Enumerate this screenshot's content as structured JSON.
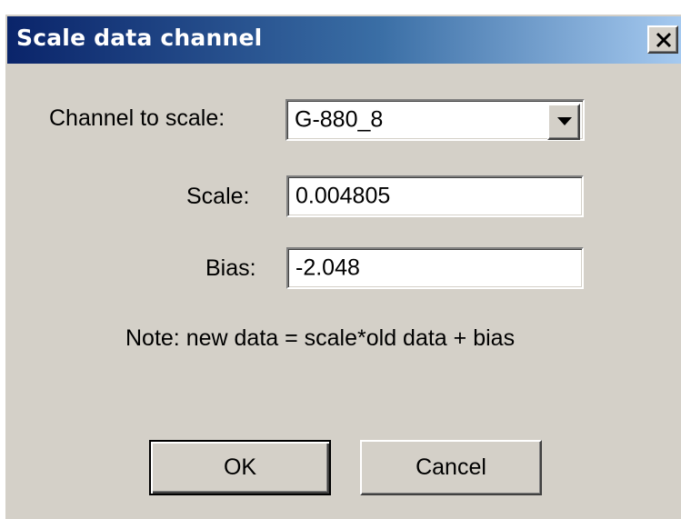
{
  "window": {
    "title": "Scale data channel",
    "close_icon": "close-x-icon"
  },
  "form": {
    "channel_label": "Channel to scale:",
    "channel_value": "G-880_8",
    "dropdown_icon": "chevron-down-icon",
    "scale_label": "Scale:",
    "scale_value": "0.004805",
    "bias_label": "Bias:",
    "bias_value": "-2.048",
    "note": "Note:  new data = scale*old data  + bias"
  },
  "buttons": {
    "ok_label": "OK",
    "cancel_label": "Cancel"
  },
  "colors": {
    "titlebar_start": "#0a246a",
    "titlebar_end": "#a6caf0",
    "face": "#d4d0c8"
  }
}
